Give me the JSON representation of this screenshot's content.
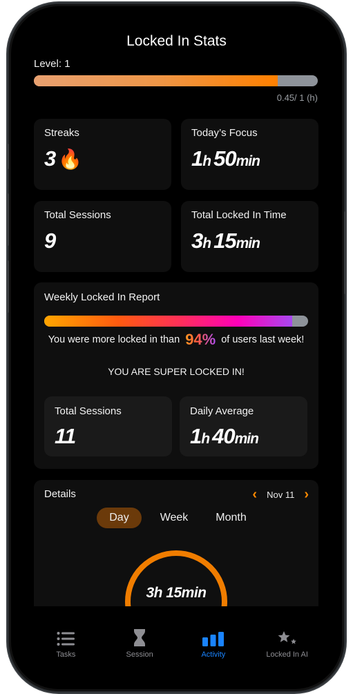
{
  "header": {
    "title": "Locked In Stats"
  },
  "level": {
    "label": "Level: 1",
    "progress_fraction": 0.86,
    "value_text": "0.45/ 1 (h)"
  },
  "stats": {
    "streaks": {
      "label": "Streaks",
      "value": "3",
      "icon": "fire-icon"
    },
    "today_focus": {
      "label": "Today’s Focus",
      "hours": "1",
      "h_unit": "h",
      "minutes": "50",
      "min_unit": "min"
    },
    "total_sessions": {
      "label": "Total Sessions",
      "value": "9"
    },
    "total_time": {
      "label": "Total Locked In Time",
      "hours": "3",
      "h_unit": "h",
      "minutes": "15",
      "min_unit": "min"
    }
  },
  "weekly": {
    "title": "Weekly Locked In Report",
    "percentile": 94,
    "msg_before": "You were more locked in than",
    "pct_text": "94%",
    "msg_after": "of  users last week!",
    "status": "YOU ARE SUPER LOCKED IN!",
    "sessions": {
      "label": "Total Sessions",
      "value": "11"
    },
    "daily_avg": {
      "label": "Daily Average",
      "hours": "1",
      "h_unit": "h",
      "minutes": "40",
      "min_unit": "min"
    }
  },
  "details": {
    "title": "Details",
    "date": "Nov 11",
    "prev_icon": "‹",
    "next_icon": "›",
    "segments": [
      "Day",
      "Week",
      "Month"
    ],
    "active_segment": "Day",
    "ring_text": "3h 15min",
    "ring_color": "#f07d00"
  },
  "tabs": [
    {
      "label": "Tasks",
      "icon": "list-icon",
      "active": false
    },
    {
      "label": "Session",
      "icon": "hourglass-icon",
      "active": false
    },
    {
      "label": "Activity",
      "icon": "bar-chart-icon",
      "active": true
    },
    {
      "label": "Locked In AI",
      "icon": "sparkle-stars-icon",
      "active": false
    }
  ],
  "colors": {
    "accent": "#ff8a00",
    "tab_active": "#1a84ff",
    "tab_inactive": "#8e8e93",
    "segment_active_bg": "#6b3a0a"
  }
}
